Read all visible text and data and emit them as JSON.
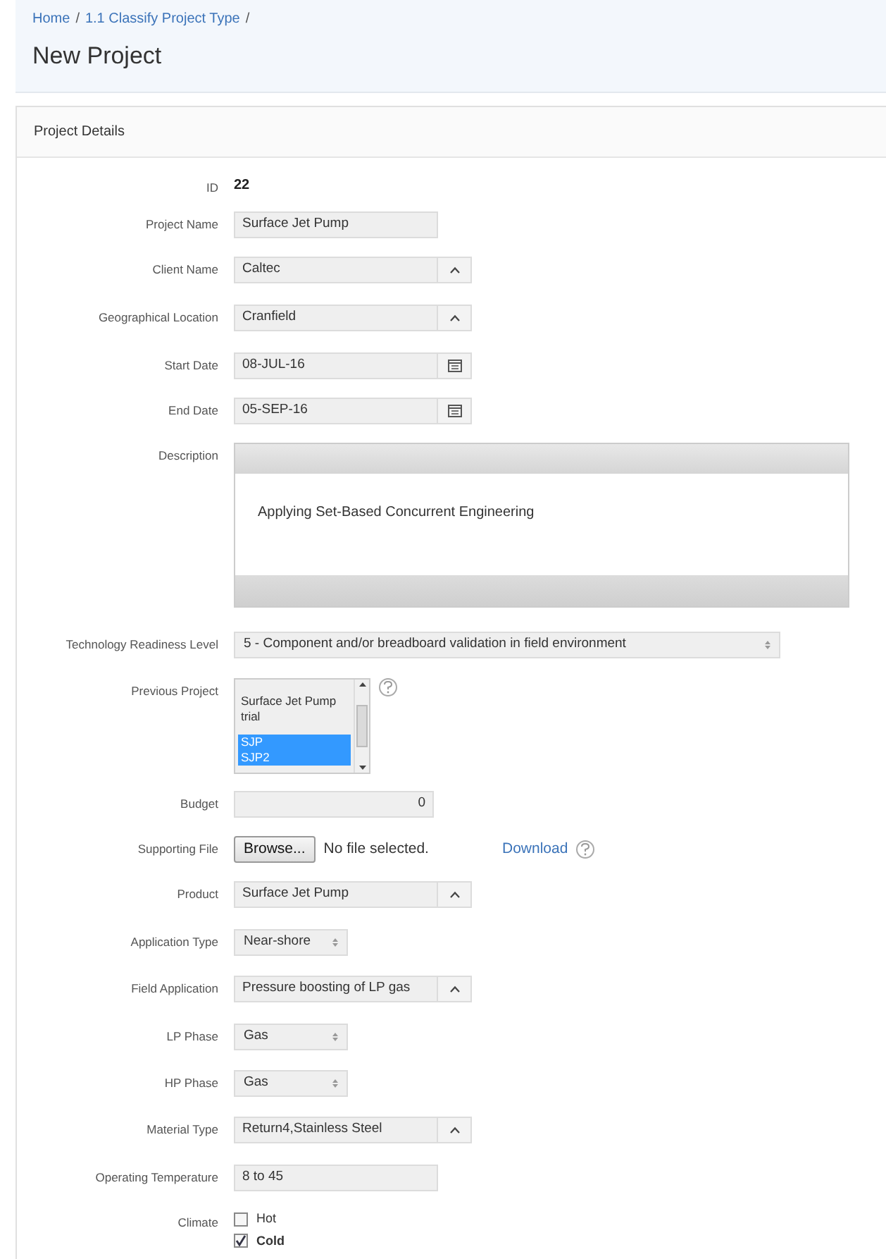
{
  "breadcrumb": [
    {
      "label": "Home",
      "separator": "/"
    },
    {
      "label": "1.1 Classify Project Type",
      "separator": "/"
    }
  ],
  "title": "New Project",
  "panel": {
    "title": "Project Details",
    "fields": [
      {
        "kind": "display",
        "label": "ID",
        "value": "22"
      },
      {
        "kind": "text",
        "label": "Project Name",
        "value": "Surface Jet Pump"
      },
      {
        "kind": "popup",
        "label": "Client Name",
        "value": "Caltec"
      },
      {
        "kind": "popup",
        "label": "Geographical Location",
        "value": "Cranfield"
      },
      {
        "kind": "date",
        "label": "Start Date",
        "value": "08-JUL-16"
      },
      {
        "kind": "date",
        "label": "End Date",
        "value": "05-SEP-16"
      },
      {
        "kind": "textarea",
        "label": "Description",
        "value": "Applying Set-Based Concurrent Engineering"
      },
      {
        "kind": "dropdown",
        "label": "Technology Readiness Level",
        "value": "5 - Component and/or breadboard validation in field environment"
      },
      {
        "kind": "listbox",
        "label": "Previous Project",
        "options": [
          {
            "label": "Surface Jet Pump trial",
            "selected": false
          },
          {
            "label": "SJP",
            "selected": true
          },
          {
            "label": "SJP2",
            "selected": true
          }
        ]
      },
      {
        "kind": "number",
        "label": "Budget",
        "value": "0"
      },
      {
        "kind": "file",
        "label": "Supporting File",
        "button": "Browse...",
        "status": "No file selected.",
        "link": "Download"
      },
      {
        "kind": "popup",
        "label": "Product",
        "value": "Surface Jet Pump"
      },
      {
        "kind": "select",
        "label": "Application Type",
        "value": "Near-shore"
      },
      {
        "kind": "popup",
        "label": "Field Application",
        "value": "Pressure boosting of LP gas"
      },
      {
        "kind": "select",
        "label": "LP Phase",
        "value": "Gas"
      },
      {
        "kind": "select",
        "label": "HP Phase",
        "value": "Gas"
      },
      {
        "kind": "popup",
        "label": "Material Type",
        "value": "Return4,Stainless Steel"
      },
      {
        "kind": "text",
        "label": "Operating Temperature",
        "value": "8 to 45"
      },
      {
        "kind": "checkboxes",
        "label": "Climate",
        "options": [
          {
            "label": "Hot",
            "checked": false
          },
          {
            "label": "Cold",
            "checked": true
          }
        ]
      }
    ]
  }
}
